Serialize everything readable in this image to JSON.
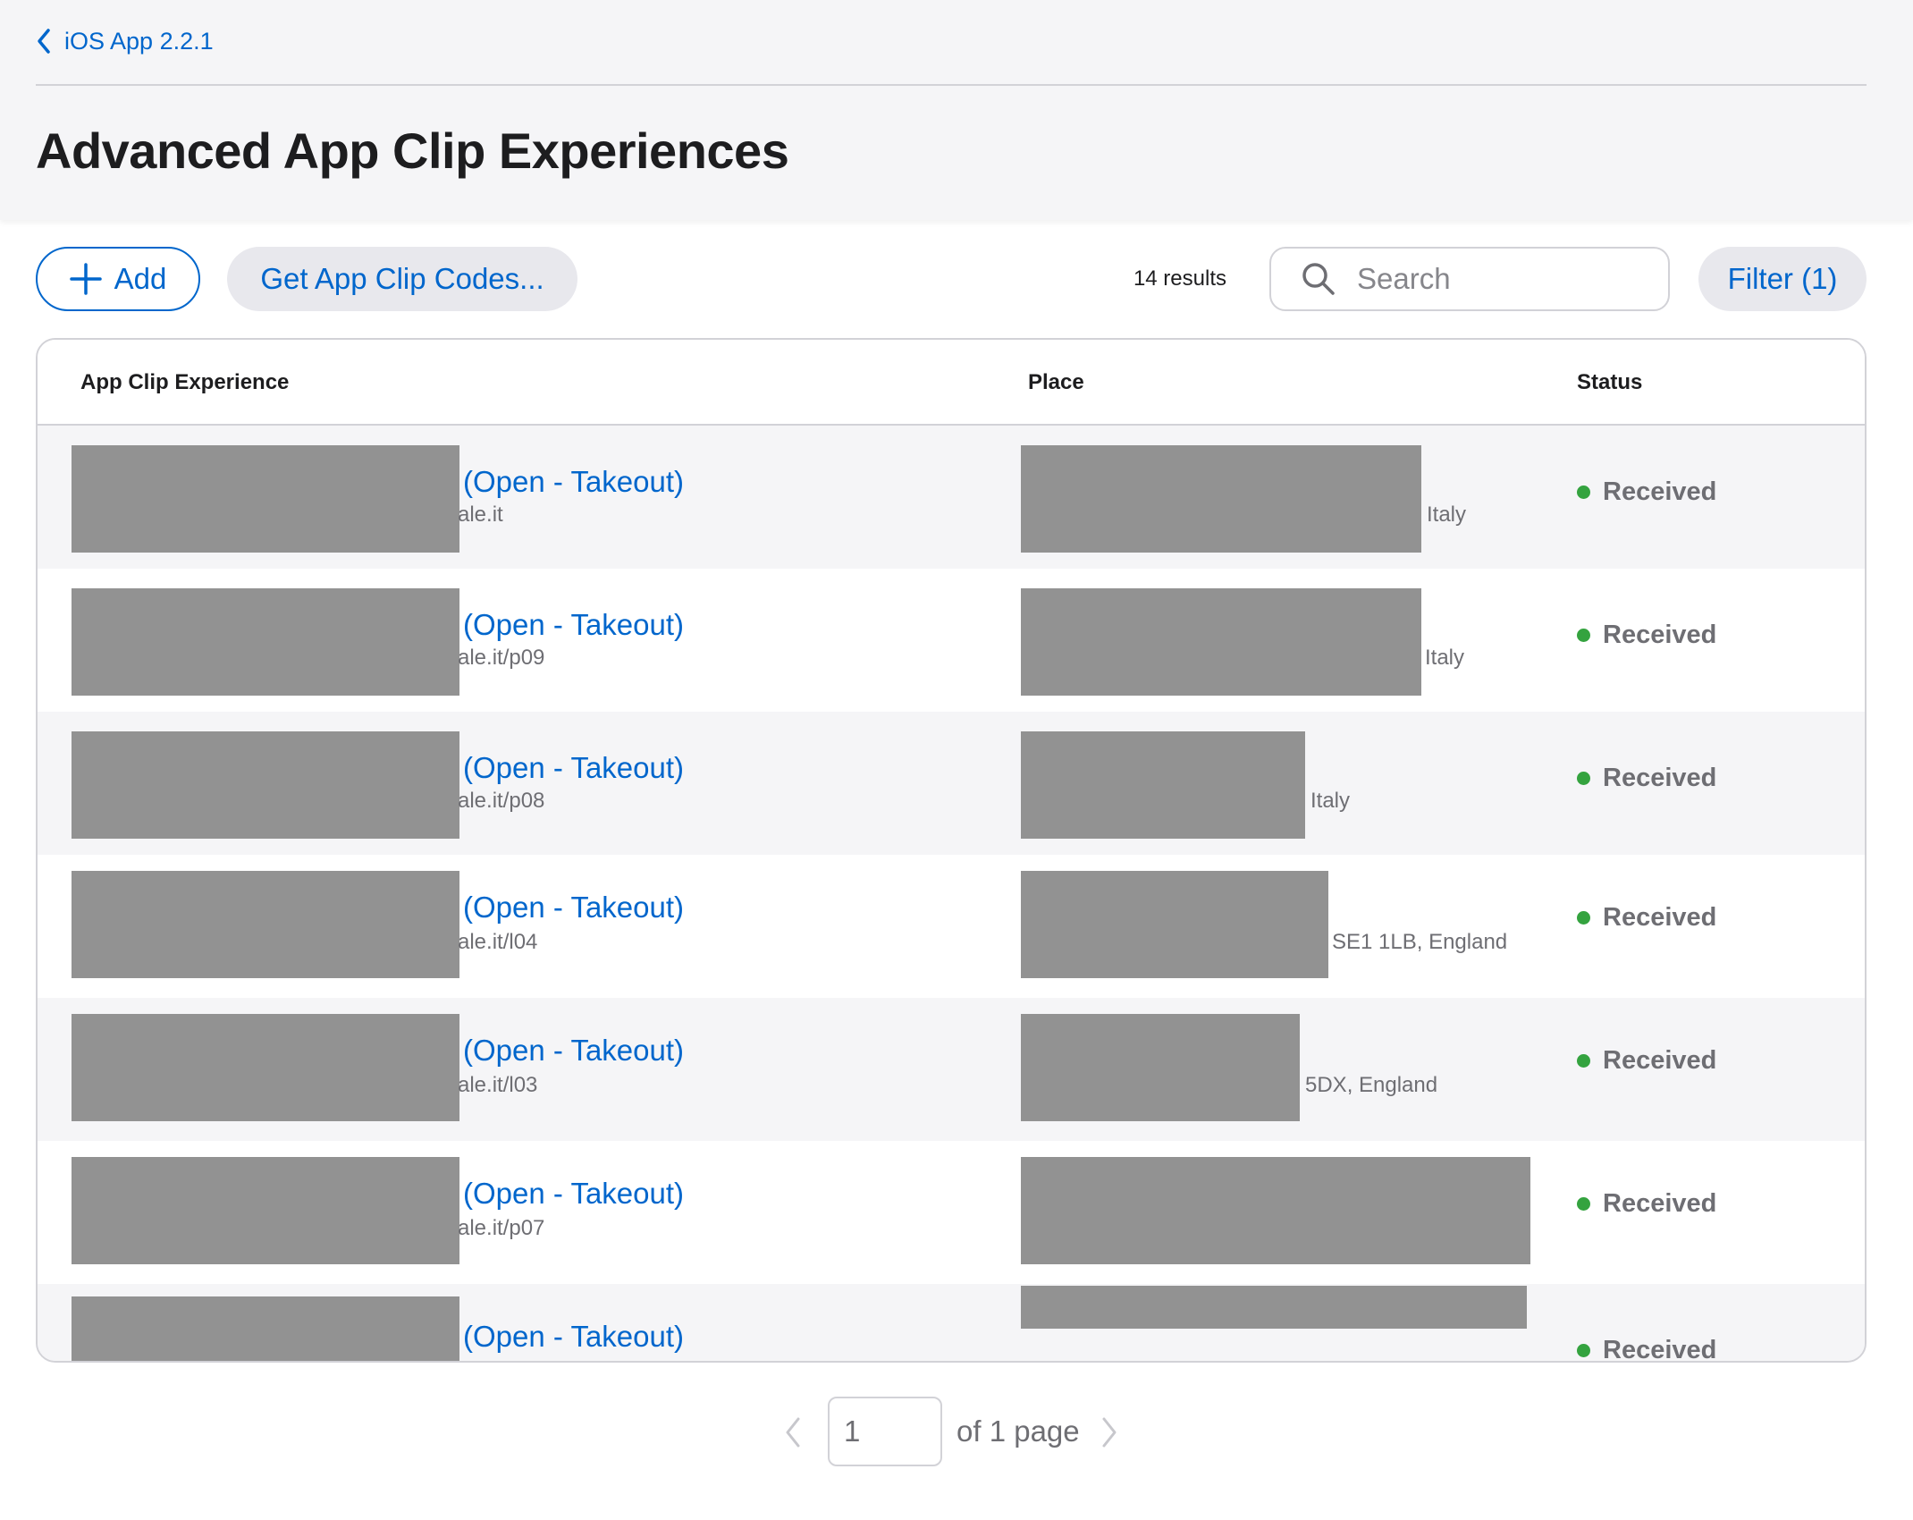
{
  "header": {
    "back_label": "iOS App 2.2.1",
    "title": "Advanced App Clip Experiences"
  },
  "toolbar": {
    "add_label": "Add",
    "codes_label": "Get App Clip Codes...",
    "results_count": "14 results",
    "search_placeholder": "Search",
    "filter_label": "Filter (1)"
  },
  "table": {
    "columns": [
      "App Clip Experience",
      "Place",
      "Status"
    ],
    "rows": [
      {
        "name": "(Open - Takeout)",
        "url": "ale.it",
        "place": "Italy",
        "status": "Received"
      },
      {
        "name": "(Open - Takeout)",
        "url": "ale.it/p09",
        "place": "Italy",
        "status": "Received"
      },
      {
        "name": "(Open - Takeout)",
        "url": "ale.it/p08",
        "place": "Italy",
        "status": "Received"
      },
      {
        "name": "(Open - Takeout)",
        "url": "ale.it/l04",
        "place": "SE1 1LB, England",
        "status": "Received"
      },
      {
        "name": "(Open - Takeout)",
        "url": "ale.it/l03",
        "place": "5DX, England",
        "status": "Received"
      },
      {
        "name": "(Open - Takeout)",
        "url": "ale.it/p07",
        "place": "",
        "status": "Received"
      },
      {
        "name": "(Open - Takeout)",
        "url": "",
        "place": "",
        "status": "Received"
      }
    ]
  },
  "pagination": {
    "current_page": "1",
    "of_label": "of 1 page"
  },
  "colors": {
    "accent": "#0066cc",
    "status_received": "#34a33f",
    "redaction": "#929292"
  },
  "icons": {
    "back": "chevron-left-icon",
    "add": "plus-icon",
    "search": "magnifying-glass-icon",
    "prev": "chevron-left-icon",
    "next": "chevron-right-icon"
  }
}
